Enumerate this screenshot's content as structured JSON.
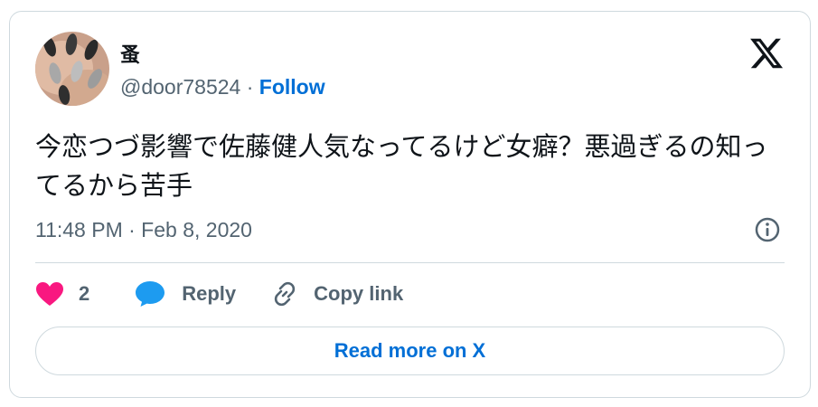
{
  "tweet": {
    "display_name": "蚤",
    "handle": "@door78524",
    "separator": " · ",
    "follow_label": "Follow",
    "text": "今恋つづ影響で佐藤健人気なってるけど女癖？悪過ぎるの知ってるから苦手",
    "timestamp": "11:48 PM · Feb 8, 2020"
  },
  "actions": {
    "like_count": "2",
    "reply_label": "Reply",
    "copy_label": "Copy link"
  },
  "read_more_label": "Read more on X",
  "colors": {
    "like": "#f91880",
    "reply": "#1d9bf0",
    "link": "#006fd6",
    "text": "#0f1419",
    "muted": "#536471",
    "border": "#cfd9de"
  },
  "icons": [
    "avatar",
    "x-logo-icon",
    "info-icon",
    "heart-icon",
    "reply-bubble-icon",
    "link-icon"
  ]
}
